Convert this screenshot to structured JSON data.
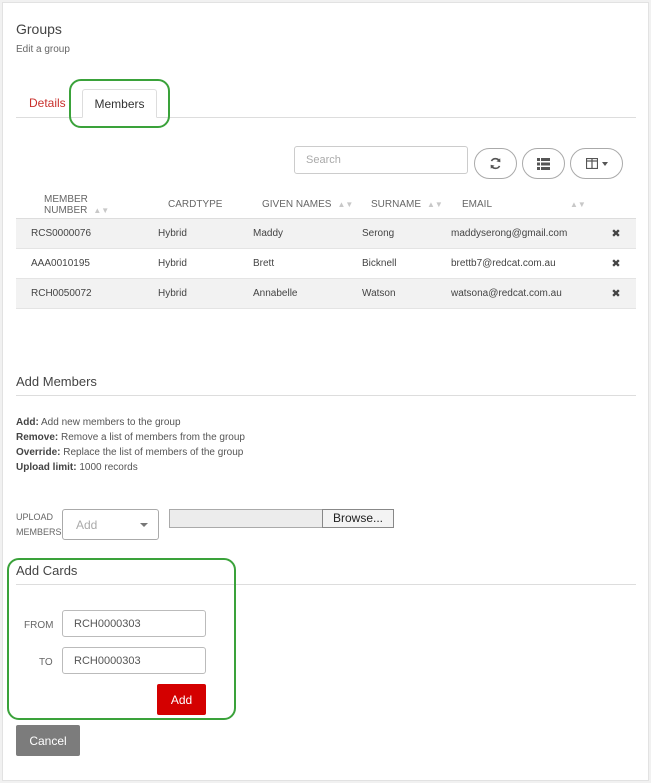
{
  "header": {
    "title": "Groups",
    "subtitle": "Edit a group"
  },
  "tabs": [
    {
      "label": "Details",
      "active": false
    },
    {
      "label": "Members",
      "active": true
    }
  ],
  "toolbar": {
    "search_placeholder": "Search",
    "refresh_icon": "refresh-icon",
    "list_icon": "list-icon",
    "columns_icon": "columns-icon"
  },
  "table": {
    "columns": [
      "MEMBER NUMBER",
      "CARDTYPE",
      "GIVEN NAMES",
      "SURNAME",
      "EMAIL"
    ],
    "rows": [
      {
        "member_number": "RCS0000076",
        "cardtype": "Hybrid",
        "given_names": "Maddy",
        "surname": "Serong",
        "email": "maddyserong@gmail.com"
      },
      {
        "member_number": "AAA0010195",
        "cardtype": "Hybrid",
        "given_names": "Brett",
        "surname": "Bicknell",
        "email": "brettb7@redcat.com.au"
      },
      {
        "member_number": "RCH0050072",
        "cardtype": "Hybrid",
        "given_names": "Annabelle",
        "surname": "Watson",
        "email": "watsona@redcat.com.au"
      }
    ]
  },
  "add_members": {
    "title": "Add Members",
    "legend": [
      {
        "term": "Add:",
        "text": " Add new members to the group"
      },
      {
        "term": "Remove:",
        "text": " Remove a list of members from the group"
      },
      {
        "term": "Override:",
        "text": " Replace the list of members of the group"
      },
      {
        "term": "Upload limit:",
        "text": " 1000 records"
      }
    ],
    "upload_label_1": "UPLOAD",
    "upload_label_2": "MEMBERS",
    "mode_placeholder": "Add",
    "browse_label": "Browse..."
  },
  "add_cards": {
    "title": "Add Cards",
    "from_label": "FROM",
    "from_value": "RCH0000303",
    "to_label": "TO",
    "to_value": "RCH0000303",
    "add_label": "Add"
  },
  "footer": {
    "cancel_label": "Cancel"
  },
  "colors": {
    "accent_red": "#d40000",
    "highlight_green": "#3aa23a",
    "tab_link_red": "#c9302c"
  }
}
